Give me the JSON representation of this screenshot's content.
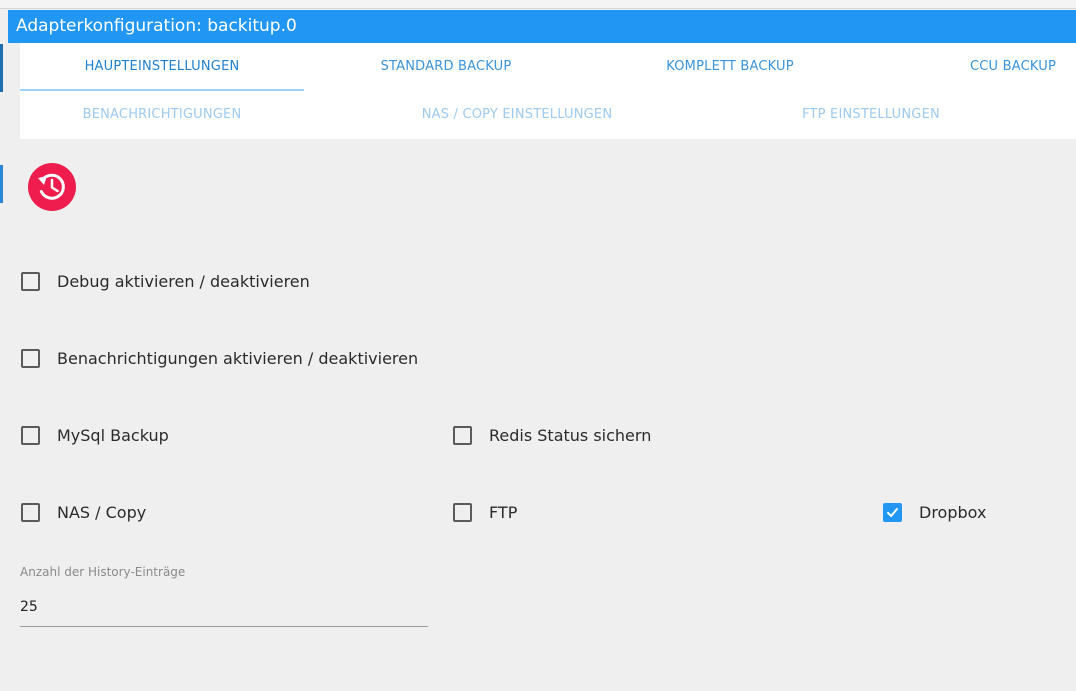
{
  "window": {
    "title": "Adapterkonfiguration: backitup.0"
  },
  "tabs": [
    {
      "label": "HAUPTEINSTELLUNGEN",
      "active": true
    },
    {
      "label": "STANDARD BACKUP"
    },
    {
      "label": "KOMPLETT BACKUP"
    },
    {
      "label": "CCU BACKUP"
    },
    {
      "label": "BENACHRICHTIGUNGEN"
    },
    {
      "label": "NAS / COPY EINSTELLUNGEN"
    },
    {
      "label": "FTP EINSTELLUNGEN"
    }
  ],
  "history_button": {
    "icon": "history-icon",
    "color": "#ee1d4e"
  },
  "options": {
    "debug": {
      "label": "Debug aktivieren / deaktivieren",
      "checked": false
    },
    "notifications": {
      "label": "Benachrichtigungen aktivieren / deaktivieren",
      "checked": false
    },
    "mysql": {
      "label": "MySql Backup",
      "checked": false
    },
    "redis": {
      "label": "Redis Status sichern",
      "checked": false
    },
    "nas": {
      "label": "NAS / Copy",
      "checked": false
    },
    "ftp": {
      "label": "FTP",
      "checked": false
    },
    "dropbox": {
      "label": "Dropbox",
      "checked": true
    }
  },
  "history_entries": {
    "label": "Anzahl der History-Einträge",
    "value": "25"
  },
  "colors": {
    "accent": "#2196f3",
    "history_button": "#ee1d4e",
    "background": "#efefef"
  }
}
